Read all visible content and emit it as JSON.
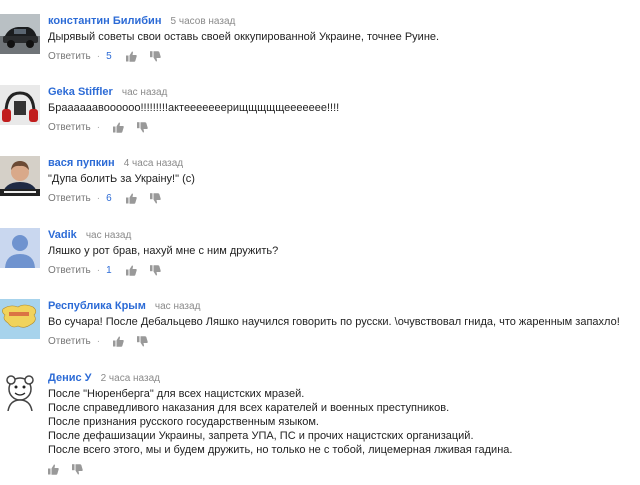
{
  "comments": [
    {
      "author": "константин Билибин",
      "time": "5 часов назад",
      "lines": [
        "Дырявый советы свои оставь  своей оккупированной  Украине, точнее Руине."
      ],
      "reply": "Ответить",
      "likes": "5",
      "avatar_icon": "car-avatar"
    },
    {
      "author": "Geka Stiffler",
      "time": "час назад",
      "lines": [
        "Браааааавоооооо!!!!!!!!!актееееееерищщщщщеееееее!!!!"
      ],
      "reply": "Ответить",
      "likes": "",
      "avatar_icon": "headphones-avatar"
    },
    {
      "author": "вася пупкин",
      "time": "4 часа назад",
      "lines": [
        "\"Дупа болитЬ за Украiну!\" (с)"
      ],
      "reply": "Ответить",
      "likes": "6",
      "avatar_icon": "portrait-avatar"
    },
    {
      "author": "Vadik",
      "time": "час назад",
      "lines": [
        "Ляшко у рот брав, нахуй мне с ним дружить?"
      ],
      "reply": "Ответить",
      "likes": "1",
      "avatar_icon": "default-user-avatar"
    },
    {
      "author": "Республика Крым",
      "time": "час назад",
      "lines": [
        "Во сучара! После Дебальцево Ляшко научился говорить по русски. \\очувствовал гнида, что жаренным запахло!"
      ],
      "reply": "Ответить",
      "likes": "",
      "avatar_icon": "crimea-map-avatar"
    },
    {
      "author": "Денис У",
      "time": "2 часа назад",
      "lines": [
        "После \"Нюренберга\" для всех нацистских мразей.",
        "После справедливого наказания для всех карателей и военных преступников.",
        "После признания русского государственным языком.",
        "После дефашизации Украины, запрета УПА, ПС и прочих нацистских организаций.",
        "После всего этого, мы и будем дружить, но только не с тобой, лицемерная лживая гадина."
      ],
      "reply": "",
      "likes": "",
      "avatar_icon": "cartoon-avatar"
    }
  ],
  "icons": {
    "like": "thumbs-up-icon",
    "dislike": "thumbs-down-icon"
  },
  "colors": {
    "author": "#2c6bd6",
    "time": "#8a8a8a",
    "text": "#222222",
    "action": "#777777"
  }
}
